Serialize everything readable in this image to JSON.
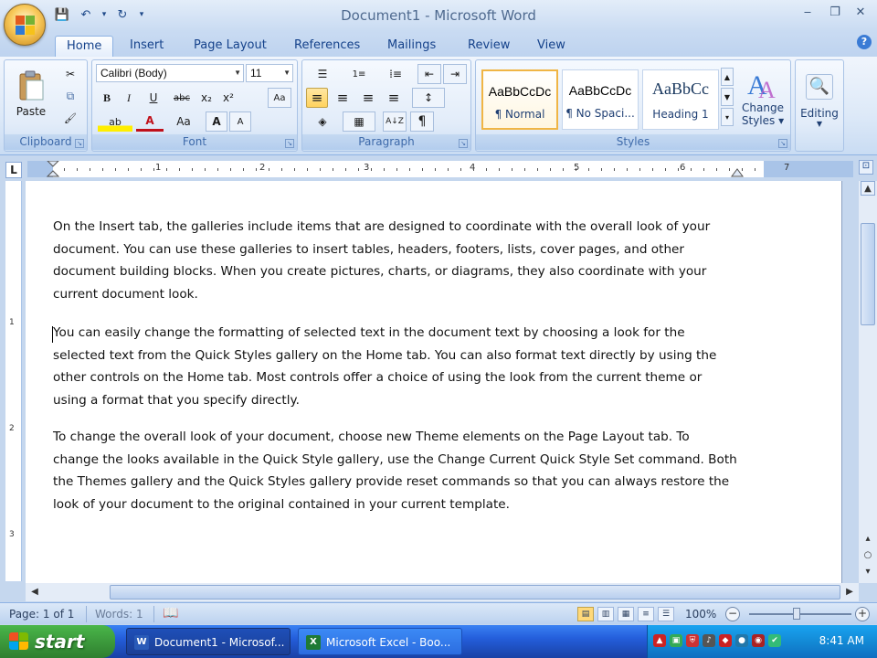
{
  "window": {
    "title": "Document1 - Microsoft Word",
    "minimize": "‒",
    "restore": "❐",
    "close": "✕"
  },
  "quick_access": {
    "save": "💾",
    "undo": "↶",
    "undo_dropdown": "▾",
    "redo": "↻",
    "customize": "▾"
  },
  "tabs": [
    "Home",
    "Insert",
    "Page Layout",
    "References",
    "Mailings",
    "Review",
    "View"
  ],
  "active_tab": "Home",
  "ribbon": {
    "clipboard": {
      "label": "Clipboard",
      "paste": "Paste",
      "cut_icon": "✂",
      "copy_icon": "⧉",
      "painter_icon": "🖌"
    },
    "font": {
      "label": "Font",
      "font_name": "Calibri (Body)",
      "font_size": "11",
      "bold": "B",
      "italic": "I",
      "underline": "U",
      "strike": "abc",
      "subscript": "x₂",
      "superscript": "x²",
      "clear": "Aa",
      "grow": "A",
      "shrink": "A",
      "change_case": "Aa",
      "font_color": "A",
      "highlight": "ab"
    },
    "paragraph": {
      "label": "Paragraph",
      "bullets": "☰",
      "numbering": "1≡",
      "multilevel": "⁞≡",
      "decrease_indent": "⇤",
      "increase_indent": "⇥",
      "align_left": "≡",
      "center": "≡",
      "align_right": "≡",
      "justify": "≡",
      "line_spacing": "↕",
      "shading": "◈",
      "borders": "▦",
      "sort": "A↓Z",
      "pilcrow": "¶"
    },
    "styles": {
      "label": "Styles",
      "items": [
        {
          "sample": "AaBbCcDc",
          "name": "¶ Normal"
        },
        {
          "sample": "AaBbCcDc",
          "name": "¶ No Spaci..."
        },
        {
          "sample": "AaBbCc",
          "name": "Heading 1"
        }
      ],
      "change_styles": "Change Styles",
      "change_styles_line1": "Change",
      "change_styles_line2": "Styles ▾"
    },
    "editing": {
      "label": "Editing",
      "icon": "🔍"
    }
  },
  "ruler": {
    "tab_selector": "L",
    "numbers": [
      "1",
      "2",
      "3",
      "4",
      "5",
      "6",
      "7"
    ]
  },
  "vruler": {
    "numbers": [
      "1",
      "2",
      "3"
    ]
  },
  "document": {
    "paragraphs": [
      "On the Insert tab, the galleries include items that are designed to coordinate with the overall look of your document. You can use these galleries to insert tables, headers, footers, lists, cover pages, and other document building blocks. When you create pictures, charts, or diagrams, they also coordinate with your current document look.",
      "You can easily change the formatting of selected text in the document text by choosing a look for the selected text from the Quick Styles gallery on the Home tab. You can also format text directly by using the other controls on the Home tab. Most controls offer a choice of using the look from the current theme or using a format that you specify directly.",
      "To change the overall look of your document, choose new Theme elements on the Page Layout tab. To change the looks available in the Quick Style gallery, use the Change Current Quick Style Set command. Both the Themes gallery and the Quick Styles gallery provide reset commands so that you can always restore the look of your document to the original contained in your current template."
    ]
  },
  "statusbar": {
    "page": "Page: 1 of 1",
    "words": "Words: 1",
    "zoom": "100%",
    "zoom_minus": "−",
    "zoom_plus": "+"
  },
  "taskbar": {
    "start": "start",
    "tasks": [
      {
        "label": "Document1 - Microsof...",
        "icon": "W",
        "color": "#2a5bb8"
      },
      {
        "label": "Microsoft Excel - Boo...",
        "icon": "X",
        "color": "#1f7a35"
      }
    ],
    "clock": "8:41 AM"
  },
  "colors": {
    "ribbon_bg": "#dde9f8",
    "accent": "#15428b",
    "selected": "#ffd35e",
    "taskbar": "#245edb",
    "start": "#3c9a3c"
  }
}
